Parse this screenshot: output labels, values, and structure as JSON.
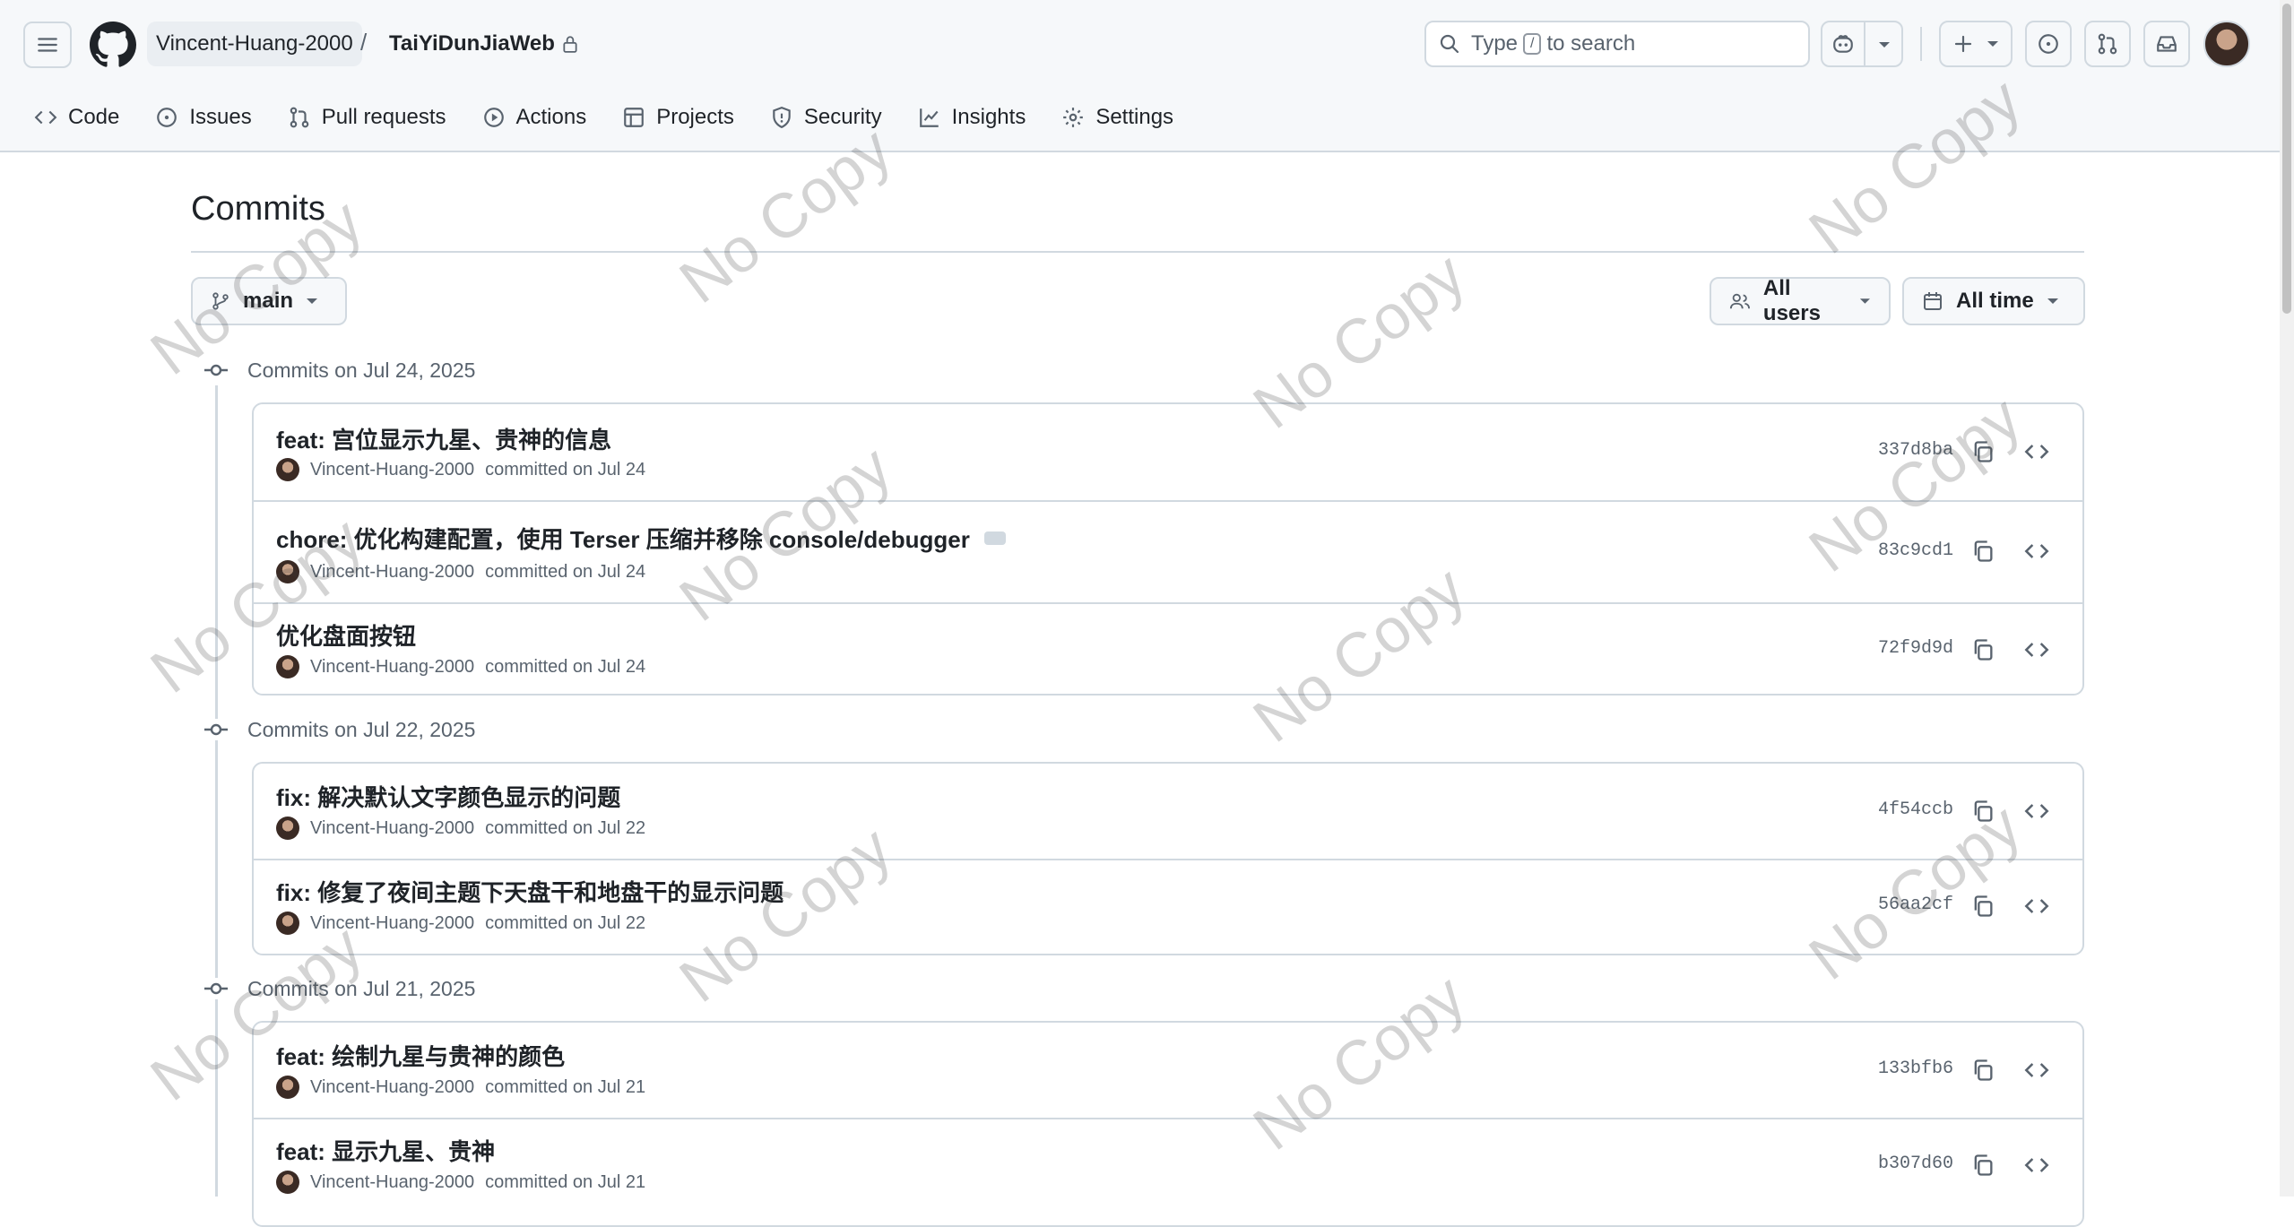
{
  "header": {
    "owner": "Vincent-Huang-2000",
    "separator": "/",
    "repo": "TaiYiDunJiaWeb",
    "search": {
      "prefix": "Type",
      "key": "/",
      "suffix": "to search"
    }
  },
  "nav": {
    "items": [
      {
        "label": "Code",
        "icon": "code-icon"
      },
      {
        "label": "Issues",
        "icon": "issue-icon"
      },
      {
        "label": "Pull requests",
        "icon": "pull-request-icon"
      },
      {
        "label": "Actions",
        "icon": "play-icon"
      },
      {
        "label": "Projects",
        "icon": "table-icon"
      },
      {
        "label": "Security",
        "icon": "shield-icon"
      },
      {
        "label": "Insights",
        "icon": "graph-icon"
      },
      {
        "label": "Settings",
        "icon": "gear-icon"
      }
    ]
  },
  "page": {
    "title": "Commits"
  },
  "filters": {
    "branch": "main",
    "users": "All users",
    "time": "All time"
  },
  "groups": [
    {
      "heading": "Commits on Jul 24, 2025",
      "commits": [
        {
          "message": "feat: 宫位显示九星、贵神的信息",
          "author": "Vincent-Huang-2000",
          "when": "committed on Jul 24",
          "sha": "337d8ba"
        },
        {
          "message": "chore: 优化构建配置，使用 Terser 压缩并移除 console/debugger",
          "author": "Vincent-Huang-2000",
          "when": "committed on Jul 24",
          "sha": "83c9cd1"
        },
        {
          "message": "优化盘面按钮",
          "author": "Vincent-Huang-2000",
          "when": "committed on Jul 24",
          "sha": "72f9d9d"
        }
      ]
    },
    {
      "heading": "Commits on Jul 22, 2025",
      "commits": [
        {
          "message": "fix: 解决默认文字颜色显示的问题",
          "author": "Vincent-Huang-2000",
          "when": "committed on Jul 22",
          "sha": "4f54ccb"
        },
        {
          "message": "fix: 修复了夜间主题下天盘干和地盘干的显示问题",
          "author": "Vincent-Huang-2000",
          "when": "committed on Jul 22",
          "sha": "56aa2cf"
        }
      ]
    },
    {
      "heading": "Commits on Jul 21, 2025",
      "commits": [
        {
          "message": "feat: 绘制九星与贵神的颜色",
          "author": "Vincent-Huang-2000",
          "when": "committed on Jul 21",
          "sha": "133bfb6"
        },
        {
          "message": "feat: 显示九星、贵神",
          "author": "Vincent-Huang-2000",
          "when": "committed on Jul 21",
          "sha": "b307d60"
        }
      ]
    }
  ],
  "watermark": "No Copy",
  "colors": {
    "border": "#d1d9e0",
    "muted": "#59636e",
    "text": "#1f2328",
    "header_bg": "#f6f8fa"
  }
}
